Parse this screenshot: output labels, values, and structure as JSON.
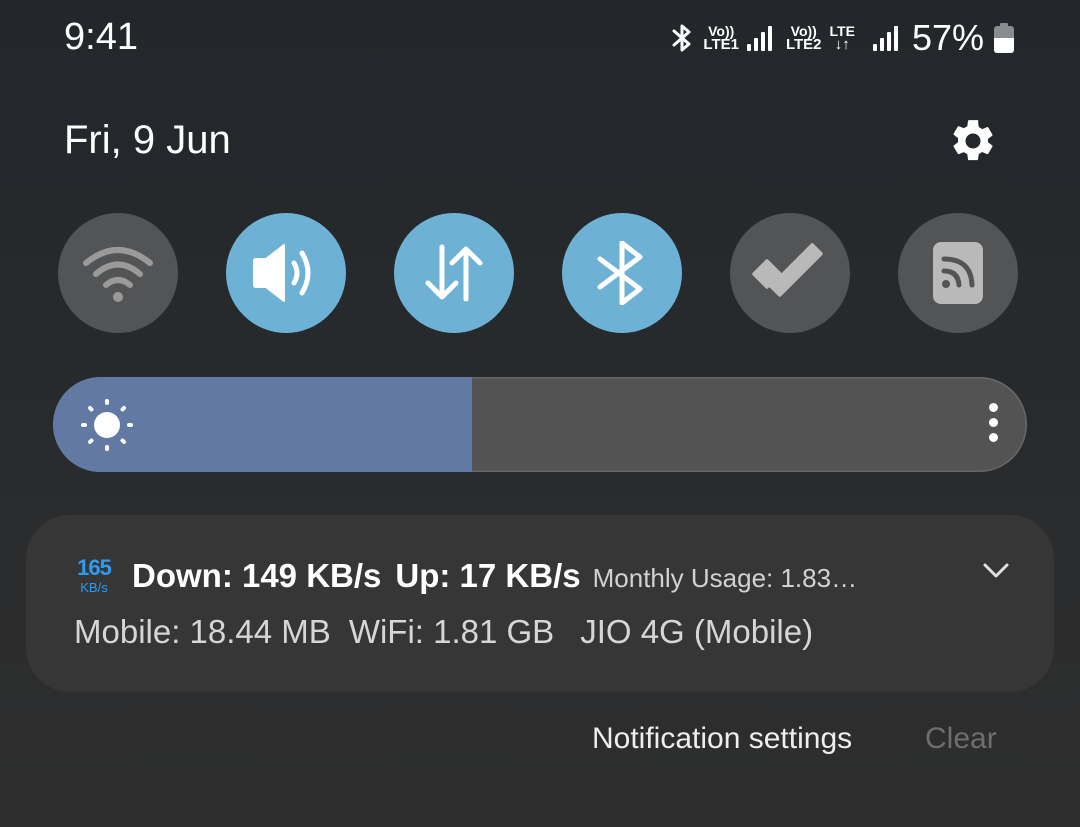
{
  "status_bar": {
    "time": "9:41",
    "icons": [
      "bluetooth-icon",
      "volte-lte1-icon",
      "signal-icon",
      "volte-lte2-icon",
      "lte-data-icon",
      "signal-icon",
      "battery-icon"
    ],
    "volte1_top": "Vo))",
    "volte1_bottom": "LTE1",
    "volte2_top": "Vo))",
    "volte2_bottom": "LTE2",
    "lte_top": "LTE",
    "lte_bottom": "↓↑",
    "battery_percent": "57%",
    "battery_level": 0.57
  },
  "header": {
    "date": "Fri, 9 Jun",
    "settings_icon": "gear-icon"
  },
  "quick_tiles": [
    {
      "name": "Wi-Fi",
      "icon": "wifi-icon",
      "state": "off"
    },
    {
      "name": "Sound",
      "icon": "volume-icon",
      "state": "on"
    },
    {
      "name": "Mobile data",
      "icon": "data-transfer-icon",
      "state": "on"
    },
    {
      "name": "Bluetooth",
      "icon": "bluetooth-icon",
      "state": "on"
    },
    {
      "name": "Tasks",
      "icon": "check-icon",
      "state": "off"
    },
    {
      "name": "Cast",
      "icon": "cast-icon",
      "state": "off"
    }
  ],
  "brightness": {
    "level": 0.43,
    "icon": "sun-icon",
    "more_icon": "more-vertical-icon",
    "colors": {
      "fill": "#6179a3",
      "track": "#535353"
    }
  },
  "notification": {
    "speed_badge_value": "165",
    "speed_badge_unit": "KB/s",
    "down": "Down: 149 KB/s",
    "up": "Up: 17 KB/s",
    "monthly": "Monthly Usage: 1.83…",
    "mobile": "Mobile: 18.44 MB",
    "wifi": "WiFi: 1.81 GB",
    "network": "JIO 4G (Mobile)",
    "expand_icon": "chevron-down-icon",
    "accent": "#2e9bf0"
  },
  "footer": {
    "notification_settings": "Notification settings",
    "clear": "Clear"
  },
  "colors": {
    "tile_on": "#6db1d5",
    "tile_off": "#525456"
  }
}
